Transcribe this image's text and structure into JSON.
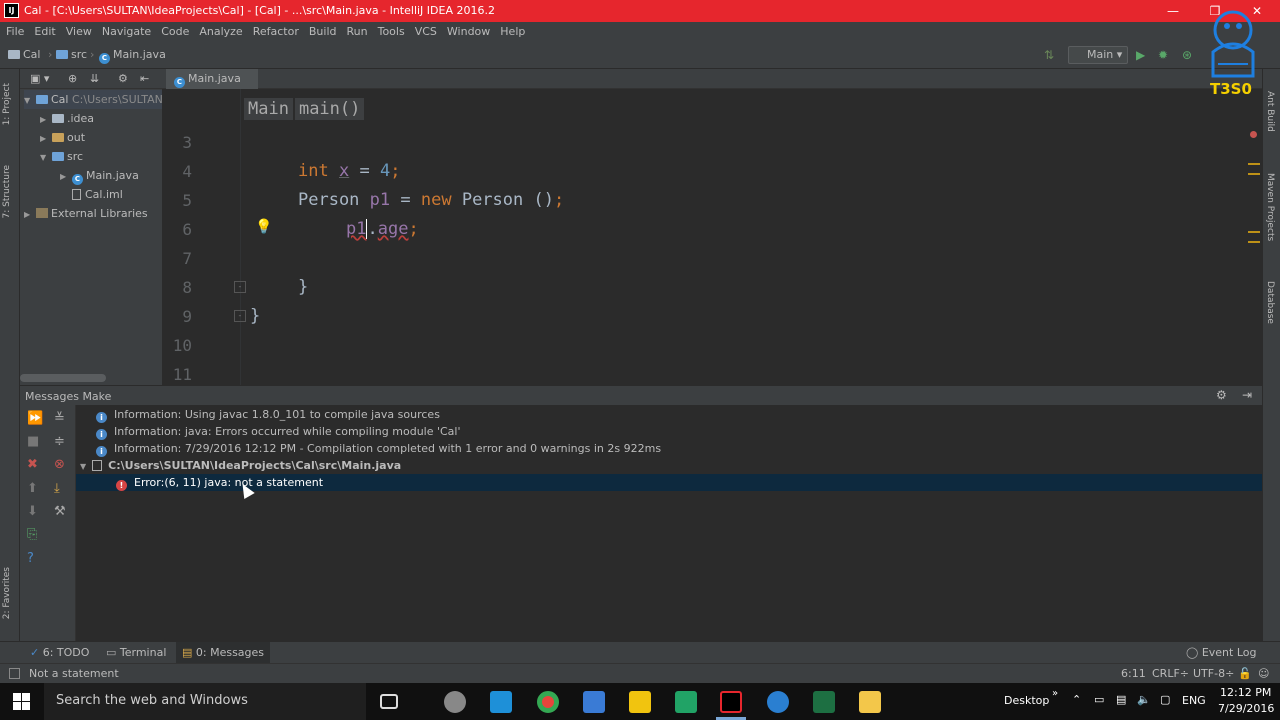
{
  "window": {
    "title": "Cal - [C:\\Users\\SULTAN\\IdeaProjects\\Cal] - [Cal] - ...\\src\\Main.java - IntelliJ IDEA 2016.2",
    "app_icon_text": "IJ",
    "minimize": "—",
    "maximize": "❐",
    "close": "✕"
  },
  "menu": [
    "File",
    "Edit",
    "View",
    "Navigate",
    "Code",
    "Analyze",
    "Refactor",
    "Build",
    "Run",
    "Tools",
    "VCS",
    "Window",
    "Help"
  ],
  "navbar": {
    "crumbs": [
      "Cal",
      "src",
      "Main.java"
    ],
    "run_config": "Main"
  },
  "left_stripe": {
    "tabs": [
      "1: Project",
      "7: Structure",
      "2: Favorites"
    ]
  },
  "right_stripe": {
    "tabs": [
      "Ant Build",
      "Maven Projects",
      "Database"
    ]
  },
  "project_tree": [
    {
      "label": "Cal",
      "suffix": "C:\\Users\\SULTAN",
      "icon": "folder-icon",
      "expanded": true,
      "depth": 0
    },
    {
      "label": ".idea",
      "icon": "folder-icon",
      "expanded": false,
      "depth": 1
    },
    {
      "label": "out",
      "icon": "folder-icon",
      "expanded": false,
      "depth": 1
    },
    {
      "label": "src",
      "icon": "folder-icon",
      "expanded": true,
      "depth": 1
    },
    {
      "label": "Main.java",
      "icon": "class-icon",
      "expanded": false,
      "depth": 2
    },
    {
      "label": "Cal.iml",
      "icon": "file-icon",
      "depth": 2
    },
    {
      "label": "External Libraries",
      "icon": "library-icon",
      "expanded": false,
      "depth": 0
    }
  ],
  "editor": {
    "tab": "Main.java",
    "breadcrumb": [
      "Main",
      "main()"
    ],
    "line_numbers": [
      "3",
      "4",
      "5",
      "6",
      "7",
      "8",
      "9",
      "10",
      "11"
    ],
    "code": {
      "l4_kw": "int",
      "l4_rest": " x = 4",
      "l4_x": "x",
      "l4_eq": " = ",
      "l4_num": "4",
      "l4_semi": ";",
      "l5_type": "Person",
      "l5_var": "p1",
      "l5_eq": " = ",
      "l5_new": "new",
      "l5_type2": " Person ()",
      "l5_semi": ";",
      "l6_obj": "p1",
      "l6_dot": ".",
      "l6_field": "age",
      "l6_semi": ";",
      "l8": "}",
      "l9": "}"
    }
  },
  "messages": {
    "title": "Messages Make",
    "rows": [
      {
        "type": "info",
        "text": "Information: Using javac 1.8.0_101 to compile java sources"
      },
      {
        "type": "info",
        "text": "Information: java: Errors occurred while compiling module 'Cal'"
      },
      {
        "type": "info",
        "text": "Information: 7/29/2016 12:12 PM - Compilation completed with 1 error and 0 warnings in 2s 922ms"
      },
      {
        "type": "file",
        "text": "C:\\Users\\SULTAN\\IdeaProjects\\Cal\\src\\Main.java"
      },
      {
        "type": "error",
        "text": "Error:(6, 11)  java: not a statement",
        "selected": true
      }
    ]
  },
  "bottom_tabs": [
    "6: TODO",
    "Terminal",
    "0: Messages"
  ],
  "event_log": "Event Log",
  "status": {
    "message": "Not a statement",
    "position": "6:11",
    "line_sep": "CRLF÷",
    "encoding": "UTF-8÷"
  },
  "taskbar": {
    "search": "Search the web and Windows",
    "desktop": "Desktop",
    "lang": "ENG",
    "time": "12:12 PM",
    "date": "7/29/2016"
  },
  "watermark": "T3S0",
  "colors": {
    "titlebar": "#e6262d",
    "panel": "#3c3f41",
    "editor_bg": "#2b2b2b",
    "keyword": "#cc7832",
    "selected_row": "#0d293e"
  }
}
